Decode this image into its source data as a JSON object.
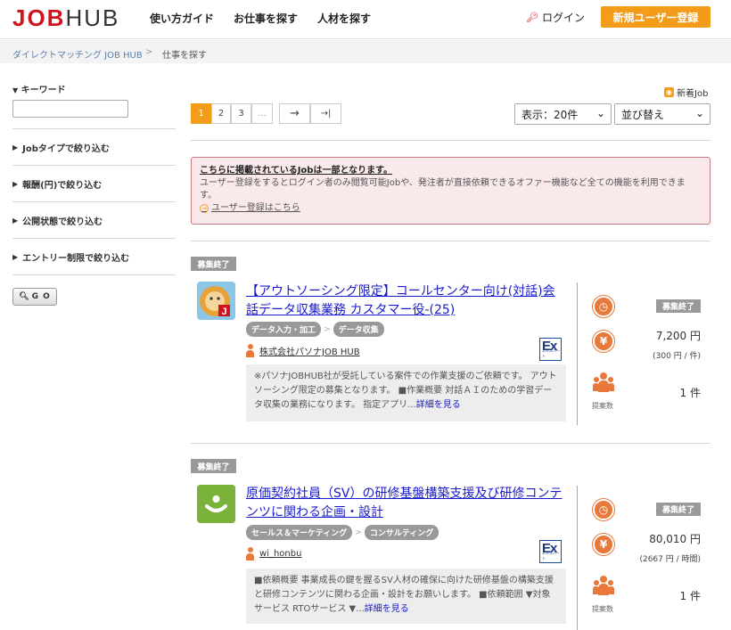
{
  "header": {
    "logo_main": "JOB",
    "logo_sub": "HUB",
    "nav": [
      "使い方ガイド",
      "お仕事を探す",
      "人材を探す"
    ],
    "login": "ログイン",
    "register": "新規ユーザー登録"
  },
  "breadcrumb": {
    "home": "ダイレクトマッチング JOB HUB",
    "sep": ">",
    "current": "仕事を探す"
  },
  "sidebar": {
    "keyword_title": "キーワード",
    "keyword_value": "",
    "filters": [
      "Jobタイプで絞り込む",
      "報酬(円)で絞り込む",
      "公開状態で絞り込む",
      "エントリー制限で絞り込む"
    ],
    "go": "G O"
  },
  "toolbar": {
    "rss": "新着Job",
    "pages": [
      "1",
      "2",
      "3",
      "..."
    ],
    "next": "→",
    "last": "→|",
    "display": "表示：20件",
    "sort": "並び替え"
  },
  "notice": {
    "title": "こちらに掲載されているJobは一部となります。",
    "body": "ユーザー登録をするとログイン者のみ閲覧可能Jobや、発注者が直接依頼できるオファー機能など全ての機能を利用できます。",
    "link": "ユーザー登録はこちら"
  },
  "jobs": [
    {
      "status": "募集終了",
      "title": "【アウトソーシング限定】コールセンター向け(対話)会話データ収集業務 カスタマー役-(25)",
      "tags": [
        "データ入力・加工",
        "データ収集"
      ],
      "company": "株式会社パソナJOB HUB",
      "description": "※パソナJOBHUB社が受託している案件での作業支援のご依頼です。 アウトソーシング限定の募集となります。 ■作業概要 対話ＡＩのための学習データ収集の業務になります。 指定アプリ...",
      "more": "詳細を見る",
      "state": "募集終了",
      "price": "7,200 円",
      "price_unit": "(300 円 / 件)",
      "proposals": "1 件",
      "proposals_label": "提案数"
    },
    {
      "status": "募集終了",
      "title": "原価契約社員（SV）の研修基盤構築支援及び研修コンテンツに関わる企画・設計",
      "tags": [
        "セールス＆マーケティング",
        "コンサルティング"
      ],
      "company": "wi_honbu",
      "description": "■依頼概要 事業成長の鍵を握るSV人材の確保に向けた研修基盤の構築支援と研修コンテンツに関わる企画・設計をお願いします。 ■依頼範囲 ▼対象サービス RTOサービス ▼...",
      "more": "詳細を見る",
      "state": "募集終了",
      "price": "80,010 円",
      "price_unit": "(2667 円 / 時間)",
      "proposals": "1 件",
      "proposals_label": "提案数"
    }
  ],
  "colors": {
    "brand": "#d0141d",
    "accent": "#f39c1a",
    "link": "#1a1acc"
  }
}
